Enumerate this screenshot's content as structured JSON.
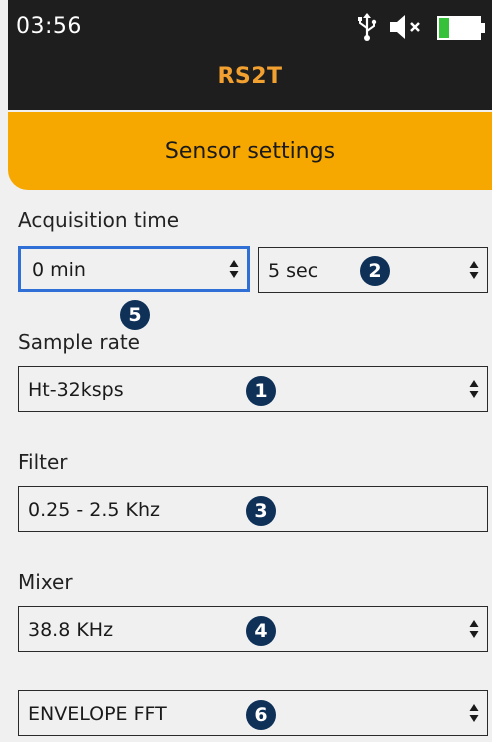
{
  "status_bar": {
    "time": "03:56",
    "icons": [
      "usb-icon",
      "mute-icon",
      "battery-icon"
    ]
  },
  "header": {
    "app_title": "RS2T"
  },
  "banner": {
    "title": "Sensor settings"
  },
  "form": {
    "acquisition_time": {
      "label": "Acquisition time",
      "minutes": "0 min",
      "seconds": "5 sec"
    },
    "sample_rate": {
      "label": "Sample rate",
      "value": "Ht-32ksps"
    },
    "filter": {
      "label": "Filter",
      "value": "0.25 - 2.5 Khz"
    },
    "mixer": {
      "label": "Mixer",
      "value": "38.8 KHz"
    },
    "mode": {
      "value": "ENVELOPE FFT"
    }
  },
  "callouts": [
    "1",
    "2",
    "3",
    "4",
    "5",
    "6"
  ],
  "colors": {
    "header_bg": "#1e1e1e",
    "accent_orange": "#f7a800",
    "title_orange": "#f2a030",
    "focus_blue": "#2f6fd6",
    "badge_navy": "#0f3158"
  }
}
